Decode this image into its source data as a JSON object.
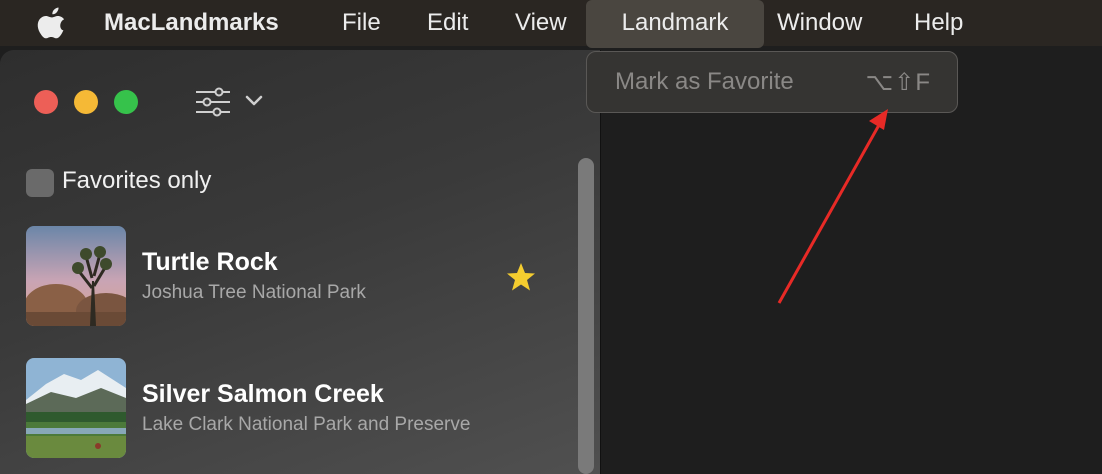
{
  "menubar": {
    "app_name": "MacLandmarks",
    "items": [
      "File",
      "Edit",
      "View",
      "Landmark",
      "Window",
      "Help"
    ],
    "active_item": "Landmark"
  },
  "dropdown": {
    "item_label": "Mark as Favorite",
    "item_shortcut": "⌥⇧F",
    "enabled": false
  },
  "sidebar": {
    "favorites_only_label": "Favorites only",
    "favorites_only_checked": false,
    "landmarks": [
      {
        "name": "Turtle Rock",
        "park": "Joshua Tree National Park",
        "is_favorite": true
      },
      {
        "name": "Silver Salmon Creek",
        "park": "Lake Clark National Park and Preserve",
        "is_favorite": false
      }
    ]
  },
  "colors": {
    "traffic_close": "#ed5f57",
    "traffic_minimize": "#f5b936",
    "traffic_zoom": "#36c24b",
    "favorite_star": "#f5cd2f",
    "annotation_arrow": "#e82a26"
  }
}
